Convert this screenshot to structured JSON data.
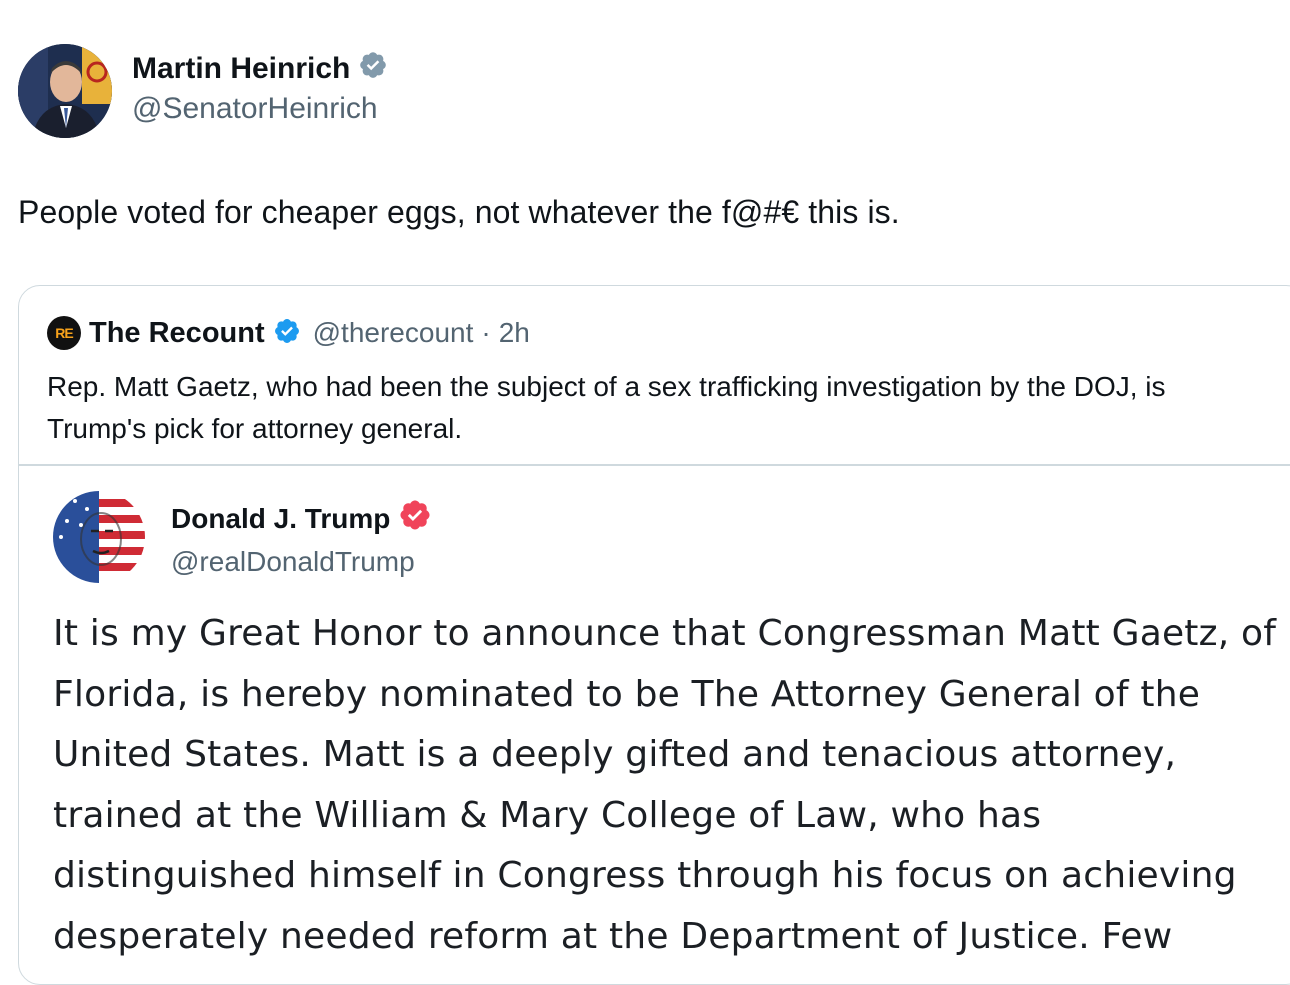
{
  "tweet": {
    "author_name": "Martin Heinrich",
    "author_handle": "@SenatorHeinrich",
    "text": "People voted for cheaper eggs, not whatever the f@#€ this is.",
    "verified_color": "#829aab"
  },
  "quoted_tweet": {
    "logo_text": "RE",
    "author_name": "The Recount",
    "author_handle": "@therecount",
    "separator": "·",
    "time": "2h",
    "text": "Rep. Matt Gaetz, who had been the subject of a sex trafficking investigation by the DOJ, is Trump's pick for attorney general.",
    "verified_color": "#1d9bf0"
  },
  "embedded_post": {
    "author_name": "Donald J. Trump",
    "author_handle": "@realDonaldTrump",
    "verified_color": "#f0445a",
    "lines": [
      "It is my Great Honor to announce that Congressman Matt Gaetz, of",
      "Florida, is hereby nominated to be The Attorney General of the",
      "United States. Matt is a deeply gifted and tenacious attorney,",
      "trained at the William & Mary College of Law, who has",
      "distinguished himself in Congress through his focus on achieving",
      "desperately needed reform at the Department of Justice. Few"
    ]
  }
}
